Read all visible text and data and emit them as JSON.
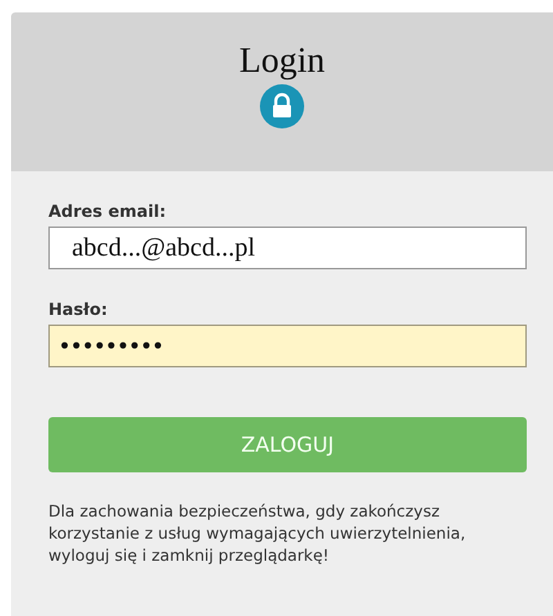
{
  "title": "Login",
  "fields": [
    {
      "label": "Adres email:",
      "value": "abcd...@abcd...pl",
      "kind": "email",
      "autofilled": false
    },
    {
      "label": "Hasło:",
      "value": "•••••••••",
      "kind": "password",
      "autofilled": true
    }
  ],
  "button": "ZALOGUJ",
  "notice": "Dla zachowania bezpieczeństwa, gdy zakończysz korzystanie z usług wymagających uwierzytelnienia, wyloguj się i zamknij przeglądarkę!"
}
